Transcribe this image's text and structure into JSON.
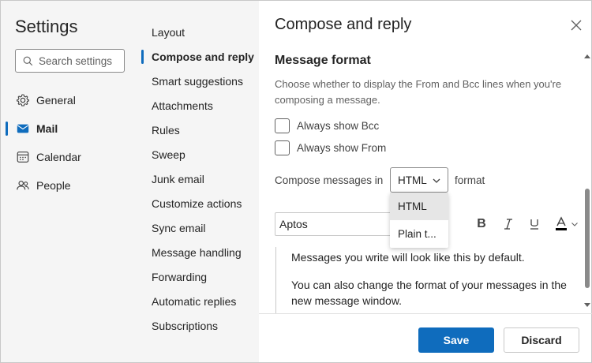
{
  "sidebar": {
    "title": "Settings",
    "search_placeholder": "Search settings",
    "items": [
      {
        "label": "General",
        "icon": "gear-icon"
      },
      {
        "label": "Mail",
        "icon": "mail-icon"
      },
      {
        "label": "Calendar",
        "icon": "calendar-icon"
      },
      {
        "label": "People",
        "icon": "people-icon"
      }
    ],
    "active": "Mail"
  },
  "subnav": {
    "items": [
      "Layout",
      "Compose and reply",
      "Smart suggestions",
      "Attachments",
      "Rules",
      "Sweep",
      "Junk email",
      "Customize actions",
      "Sync email",
      "Message handling",
      "Forwarding",
      "Automatic replies",
      "Subscriptions"
    ],
    "active": "Compose and reply"
  },
  "panel": {
    "title": "Compose and reply",
    "section_title": "Message format",
    "section_desc": "Choose whether to display the From and Bcc lines when you're composing a message.",
    "always_bcc": "Always show Bcc",
    "always_from": "Always show From",
    "compose_prefix": "Compose messages in",
    "compose_value": "HTML",
    "compose_suffix": "format",
    "format_options": [
      "HTML",
      "Plain t..."
    ],
    "font_name": "Aptos",
    "preview_line1": "Messages you write will look like this by default.",
    "preview_line2": "You can also change the format of your messages in the new message window."
  },
  "footer": {
    "save_label": "Save",
    "discard_label": "Discard"
  },
  "colors": {
    "accent": "#0f6cbd",
    "nav_bg": "#f5f5f5"
  }
}
